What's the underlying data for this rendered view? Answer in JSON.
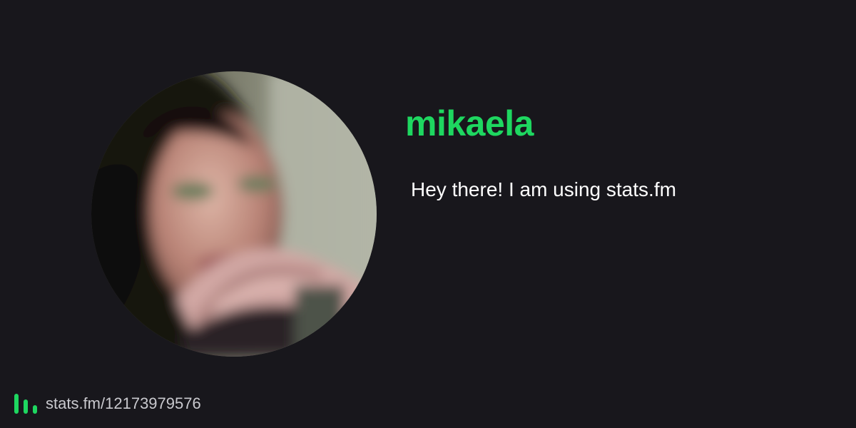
{
  "profile": {
    "display_name": "mikaela",
    "bio": "Hey there! I am using stats.fm",
    "avatar_icon": "user-avatar"
  },
  "footer": {
    "logo_icon": "stats-bars-icon",
    "profile_url": "stats.fm/12173979576"
  },
  "colors": {
    "background": "#18171c",
    "accent": "#1ed760",
    "text": "#ffffff",
    "muted_text": "#c9c9ce"
  }
}
